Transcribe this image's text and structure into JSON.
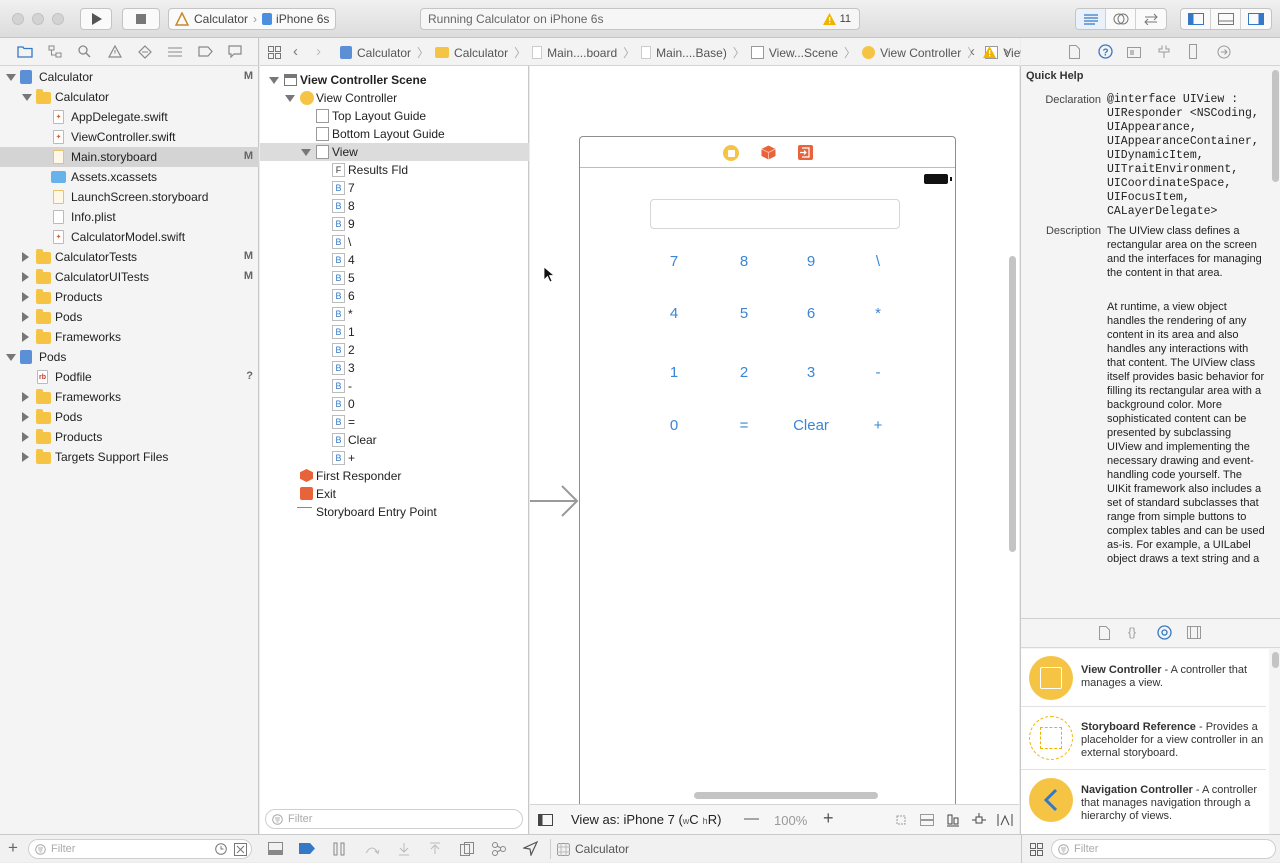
{
  "toolbar": {
    "scheme_target": "Calculator",
    "scheme_device": "iPhone 6s",
    "activity_text": "Running Calculator on iPhone 6s",
    "warning_count": "11"
  },
  "jumpbar": {
    "items": [
      "Calculator",
      "Calculator",
      "Main....board",
      "Main....Base)",
      "View...Scene",
      "View Controller",
      "View"
    ]
  },
  "navigator": {
    "items": [
      {
        "label": "Calculator",
        "badge": "M"
      },
      {
        "label": "Calculator",
        "badge": ""
      },
      {
        "label": "AppDelegate.swift",
        "badge": ""
      },
      {
        "label": "ViewController.swift",
        "badge": ""
      },
      {
        "label": "Main.storyboard",
        "badge": "M"
      },
      {
        "label": "Assets.xcassets",
        "badge": ""
      },
      {
        "label": "LaunchScreen.storyboard",
        "badge": ""
      },
      {
        "label": "Info.plist",
        "badge": ""
      },
      {
        "label": "CalculatorModel.swift",
        "badge": ""
      },
      {
        "label": "CalculatorTests",
        "badge": "M"
      },
      {
        "label": "CalculatorUITests",
        "badge": "M"
      },
      {
        "label": "Products",
        "badge": ""
      },
      {
        "label": "Pods",
        "badge": ""
      },
      {
        "label": "Frameworks",
        "badge": ""
      },
      {
        "label": "Pods",
        "badge": ""
      },
      {
        "label": "Podfile",
        "badge": "?"
      },
      {
        "label": "Frameworks",
        "badge": ""
      },
      {
        "label": "Pods",
        "badge": ""
      },
      {
        "label": "Products",
        "badge": ""
      },
      {
        "label": "Targets Support Files",
        "badge": ""
      }
    ],
    "filter_placeholder": "Filter"
  },
  "outline": {
    "items": [
      {
        "icon": "",
        "label": "View Controller Scene"
      },
      {
        "icon": "",
        "label": "View Controller"
      },
      {
        "icon": "",
        "label": "Top Layout Guide"
      },
      {
        "icon": "",
        "label": "Bottom Layout Guide"
      },
      {
        "icon": "",
        "label": "View"
      },
      {
        "icon": "F",
        "label": "Results Fld"
      },
      {
        "icon": "B",
        "label": "7"
      },
      {
        "icon": "B",
        "label": "8"
      },
      {
        "icon": "B",
        "label": "9"
      },
      {
        "icon": "B",
        "label": "\\"
      },
      {
        "icon": "B",
        "label": "4"
      },
      {
        "icon": "B",
        "label": "5"
      },
      {
        "icon": "B",
        "label": "6"
      },
      {
        "icon": "B",
        "label": "*"
      },
      {
        "icon": "B",
        "label": "1"
      },
      {
        "icon": "B",
        "label": "2"
      },
      {
        "icon": "B",
        "label": "3"
      },
      {
        "icon": "B",
        "label": "-"
      },
      {
        "icon": "B",
        "label": "0"
      },
      {
        "icon": "B",
        "label": "="
      },
      {
        "icon": "B",
        "label": "Clear"
      },
      {
        "icon": "B",
        "label": "+"
      },
      {
        "icon": "",
        "label": "First Responder"
      },
      {
        "icon": "",
        "label": "Exit"
      },
      {
        "icon": "",
        "label": "Storyboard Entry Point"
      }
    ],
    "filter_placeholder": "Filter"
  },
  "canvas": {
    "buttons": [
      [
        "7",
        "8",
        "9",
        "\\"
      ],
      [
        "4",
        "5",
        "6",
        "*"
      ],
      [
        "1",
        "2",
        "3",
        "-"
      ],
      [
        "0",
        "=",
        "Clear",
        "+"
      ]
    ],
    "view_as": "View as: iPhone 7 (",
    "view_as_w": "w",
    "view_as_c": "C",
    "view_as_h": "h",
    "view_as_r": "R)",
    "zoom": "100%",
    "accent_color": "#3b86d4"
  },
  "quick_help": {
    "title": "Quick Help",
    "declaration_label": "Declaration",
    "declaration_lines": [
      "@interface UIView :",
      "UIResponder <NSCoding,",
      "UIAppearance,",
      "UIAppearanceContainer,",
      "UIDynamicItem,",
      "UITraitEnvironment,",
      "UICoordinateSpace,",
      "UIFocusItem,",
      "CALayerDelegate>"
    ],
    "description_label": "Description",
    "description_p1": "The UIView class defines a rectangular area on the screen and the interfaces for managing the content in that area.",
    "description_p2": "At runtime, a view object handles the rendering of any content in its area and also handles any interactions with that content. The UIView class itself provides basic behavior for filling its rectangular area with a background color. More sophisticated content can be presented by subclassing UIView and implementing the necessary drawing and event-handling code yourself. The UIKit framework also includes a set of standard subclasses that range from simple buttons to complex tables and can be used as-is. For example, a UILabel object draws a text string and a"
  },
  "library": {
    "items": [
      {
        "name": "View Controller",
        "desc": " - A controller that manages a view."
      },
      {
        "name": "Storyboard Reference",
        "desc": " - Provides a placeholder for a view controller in an external storyboard."
      },
      {
        "name": "Navigation Controller",
        "desc": " - A controller that manages navigation through a hierarchy of views."
      }
    ],
    "filter_placeholder": "Filter"
  },
  "debug_bar": {
    "target": "Calculator"
  },
  "colors": {
    "folder": "#f5c445",
    "warning": "#f0b400",
    "accent": "#3b86d4",
    "storyboard_orange": "#e8623a"
  }
}
